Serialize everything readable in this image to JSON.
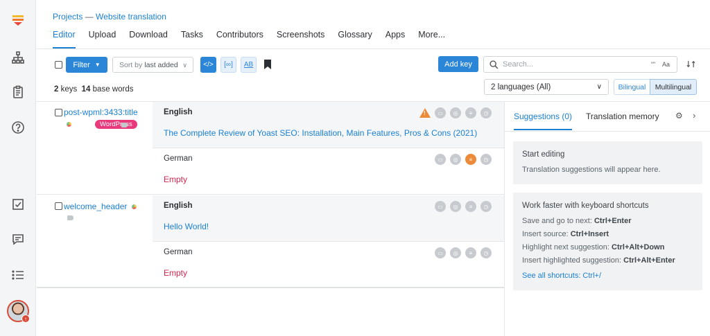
{
  "breadcrumb": {
    "projects": "Projects",
    "sep": "—",
    "project": "Website translation"
  },
  "tabs": [
    "Editor",
    "Upload",
    "Download",
    "Tasks",
    "Contributors",
    "Screenshots",
    "Glossary",
    "Apps",
    "More..."
  ],
  "toolbar": {
    "filter_label": "Filter",
    "sort_prefix": "Sort by",
    "sort_value": "last added",
    "add_key_label": "Add key",
    "search_placeholder": "Search...",
    "search_opt_regex": "“”",
    "search_opt_case": "Aa"
  },
  "summary": {
    "keys_count": "2",
    "keys_label": "keys",
    "words_count": "14",
    "words_label": "base words"
  },
  "language_select": "2 languages (All)",
  "view_toggle": {
    "bilingual": "Bilingual",
    "multilingual": "Multilingual"
  },
  "keys": [
    {
      "name": "post-wpml:3433:title",
      "tag": "WordPress",
      "source_lang": "English",
      "source_text": "The Complete Review of Yoast SEO: Installation, Main Features, Pros & Cons (2021)",
      "target_lang": "German",
      "target_text": "Empty"
    },
    {
      "name": "welcome_header",
      "source_lang": "English",
      "source_text": "Hello World!",
      "target_lang": "German",
      "target_text": "Empty"
    }
  ],
  "panel": {
    "tab_suggestions": "Suggestions (0)",
    "tab_memory": "Translation memory",
    "start_title": "Start editing",
    "start_text": "Translation suggestions will appear here.",
    "shortcuts_title": "Work faster with keyboard shortcuts",
    "shortcuts": [
      {
        "label": "Save and go to next:",
        "keys": "Ctrl+Enter"
      },
      {
        "label": "Insert source:",
        "keys": "Ctrl+Insert"
      },
      {
        "label": "Highlight next suggestion:",
        "keys": "Ctrl+Alt+Down"
      },
      {
        "label": "Insert highlighted suggestion:",
        "keys": "Ctrl+Alt+Enter"
      }
    ],
    "all_shortcuts": "See all shortcuts: Ctrl+/"
  },
  "colors": {
    "accent": "#2b86d8",
    "empty": "#d4264f",
    "badge": "#e83a7c",
    "warning": "#ec8a3a"
  }
}
